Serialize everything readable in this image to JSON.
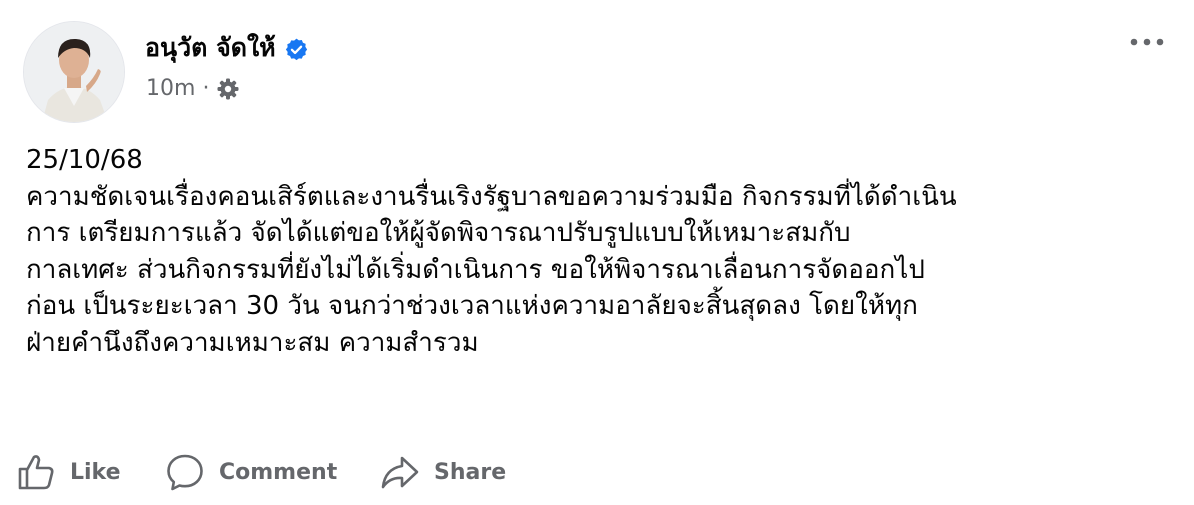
{
  "post": {
    "author": "อนุวัต จัดให้",
    "time": "10m",
    "separator": "·",
    "privacy_icon": "gear-icon",
    "verified_icon": "verified-badge-icon",
    "verified_color": "#1877f2",
    "more_icon": "more-options-icon",
    "text_lines": [
      "25/10/68",
      "ความชัดเจนเรื่องคอนเสิร์ตและงานรื่นเริงรัฐบาลขอความร่วมมือ กิจกรรมที่ได้ดำเนิน",
      "การ เตรียมการแล้ว จัดได้แต่ขอให้ผู้จัดพิจารณาปรับรูปแบบให้เหมาะสมกับ",
      "กาลเทศะ  ส่วนกิจกรรมที่ยังไม่ได้เริ่มดำเนินการ  ขอให้พิจารณาเลื่อนการจัดออกไป",
      "ก่อน เป็นระยะเวลา 30 วัน จนกว่าช่วงเวลาแห่งความอาลัยจะสิ้นสุดลง โดยให้ทุก",
      "ฝ่ายคำนึงถึงความเหมาะสม ความสำรวม"
    ]
  },
  "actions": {
    "like_label": "Like",
    "comment_label": "Comment",
    "share_label": "Share",
    "text_color": "#65676b"
  }
}
